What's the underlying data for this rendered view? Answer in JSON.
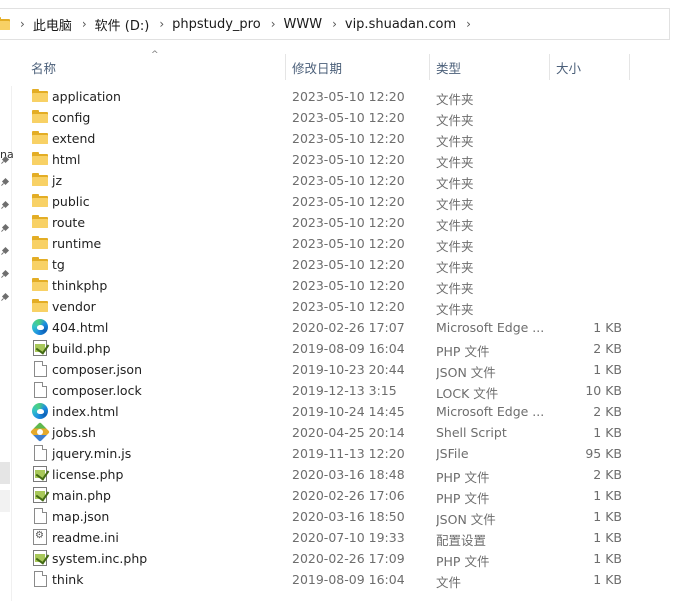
{
  "address": {
    "crumbs": [
      "此电脑",
      "软件 (D:)",
      "phpstudy_pro",
      "WWW",
      "vip.shuadan.com"
    ],
    "separator": "›"
  },
  "nav": {
    "cut_text": "na"
  },
  "columns": {
    "name": "名称",
    "date": "修改日期",
    "type": "类型",
    "size": "大小",
    "sort_indicator": "^"
  },
  "files": [
    {
      "name": "application",
      "date": "2023-05-10 12:20",
      "type": "文件夹",
      "size": "",
      "icon": "folder-icon"
    },
    {
      "name": "config",
      "date": "2023-05-10 12:20",
      "type": "文件夹",
      "size": "",
      "icon": "folder-icon"
    },
    {
      "name": "extend",
      "date": "2023-05-10 12:20",
      "type": "文件夹",
      "size": "",
      "icon": "folder-icon"
    },
    {
      "name": "html",
      "date": "2023-05-10 12:20",
      "type": "文件夹",
      "size": "",
      "icon": "folder-icon"
    },
    {
      "name": "jz",
      "date": "2023-05-10 12:20",
      "type": "文件夹",
      "size": "",
      "icon": "folder-icon"
    },
    {
      "name": "public",
      "date": "2023-05-10 12:20",
      "type": "文件夹",
      "size": "",
      "icon": "folder-icon"
    },
    {
      "name": "route",
      "date": "2023-05-10 12:20",
      "type": "文件夹",
      "size": "",
      "icon": "folder-icon"
    },
    {
      "name": "runtime",
      "date": "2023-05-10 12:20",
      "type": "文件夹",
      "size": "",
      "icon": "folder-icon"
    },
    {
      "name": "tg",
      "date": "2023-05-10 12:20",
      "type": "文件夹",
      "size": "",
      "icon": "folder-icon"
    },
    {
      "name": "thinkphp",
      "date": "2023-05-10 12:20",
      "type": "文件夹",
      "size": "",
      "icon": "folder-icon"
    },
    {
      "name": "vendor",
      "date": "2023-05-10 12:20",
      "type": "文件夹",
      "size": "",
      "icon": "folder-icon"
    },
    {
      "name": "404.html",
      "date": "2020-02-26 17:07",
      "type": "Microsoft Edge ...",
      "size": "1 KB",
      "icon": "edge-icon"
    },
    {
      "name": "build.php",
      "date": "2019-08-09 16:04",
      "type": "PHP 文件",
      "size": "2 KB",
      "icon": "php-file-icon"
    },
    {
      "name": "composer.json",
      "date": "2019-10-23 20:44",
      "type": "JSON 文件",
      "size": "1 KB",
      "icon": "file-icon"
    },
    {
      "name": "composer.lock",
      "date": "2019-12-13 3:15",
      "type": "LOCK 文件",
      "size": "10 KB",
      "icon": "file-icon"
    },
    {
      "name": "index.html",
      "date": "2019-10-24 14:45",
      "type": "Microsoft Edge ...",
      "size": "2 KB",
      "icon": "edge-icon"
    },
    {
      "name": "jobs.sh",
      "date": "2020-04-25 20:14",
      "type": "Shell Script",
      "size": "1 KB",
      "icon": "script-icon"
    },
    {
      "name": "jquery.min.js",
      "date": "2019-11-13 12:20",
      "type": "JSFile",
      "size": "95 KB",
      "icon": "file-icon"
    },
    {
      "name": "license.php",
      "date": "2020-03-16 18:48",
      "type": "PHP 文件",
      "size": "2 KB",
      "icon": "php-file-icon"
    },
    {
      "name": "main.php",
      "date": "2020-02-26 17:06",
      "type": "PHP 文件",
      "size": "1 KB",
      "icon": "php-file-icon"
    },
    {
      "name": "map.json",
      "date": "2020-03-16 18:50",
      "type": "JSON 文件",
      "size": "1 KB",
      "icon": "file-icon"
    },
    {
      "name": "readme.ini",
      "date": "2020-07-10 19:33",
      "type": "配置设置",
      "size": "1 KB",
      "icon": "settings-file-icon"
    },
    {
      "name": "system.inc.php",
      "date": "2020-02-26 17:09",
      "type": "PHP 文件",
      "size": "1 KB",
      "icon": "php-file-icon"
    },
    {
      "name": "think",
      "date": "2019-08-09 16:04",
      "type": "文件",
      "size": "1 KB",
      "icon": "file-icon"
    }
  ]
}
